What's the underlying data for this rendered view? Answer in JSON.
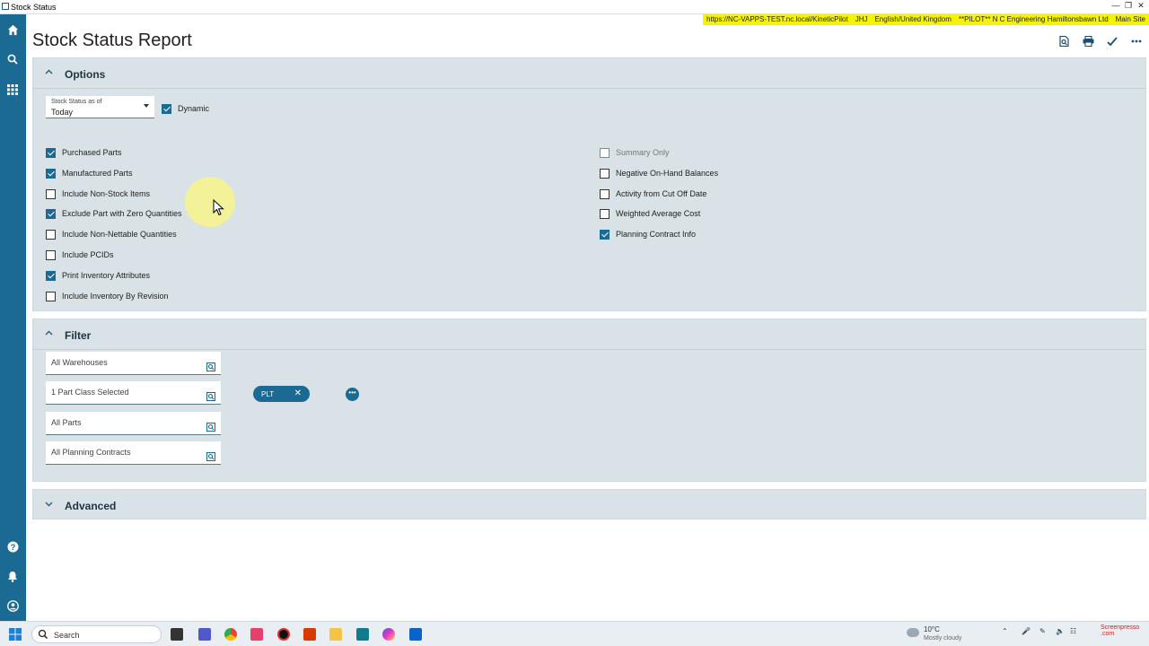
{
  "window": {
    "title": "Stock Status"
  },
  "infobar": {
    "items": [
      "https://NC-VAPPS-TEST.nc.local/KineticPilot",
      "JHJ",
      "English/United Kingdom",
      "**PILOT** N C Engineering Hamiltonsbawn Ltd",
      "Main Site"
    ]
  },
  "page": {
    "title": "Stock Status Report"
  },
  "toolbar": {
    "icons": [
      "preview-icon",
      "print-icon",
      "submit-icon",
      "more-icon"
    ]
  },
  "options": {
    "title": "Options",
    "stock_status": {
      "label": "Stock Status as of",
      "value": "Today"
    },
    "dynamic": {
      "label": "Dynamic",
      "checked": true
    },
    "left": [
      {
        "label": "Purchased Parts",
        "checked": true
      },
      {
        "label": "Manufactured Parts",
        "checked": true
      },
      {
        "label": "Include Non-Stock Items",
        "checked": false
      },
      {
        "label": "Exclude Part with Zero Quantities",
        "checked": true
      },
      {
        "label": "Include Non-Nettable Quantities",
        "checked": false
      },
      {
        "label": "Include PCIDs",
        "checked": false
      },
      {
        "label": "Print Inventory Attributes",
        "checked": true
      },
      {
        "label": "Include Inventory By Revision",
        "checked": false
      }
    ],
    "right": [
      {
        "label": "Summary Only",
        "checked": false,
        "disabled": true
      },
      {
        "label": "Negative On-Hand Balances",
        "checked": false
      },
      {
        "label": "Activity from Cut Off Date",
        "checked": false
      },
      {
        "label": "Weighted Average Cost",
        "checked": false
      },
      {
        "label": "Planning Contract Info",
        "checked": true
      }
    ]
  },
  "filter": {
    "title": "Filter",
    "lookups": [
      "All Warehouses",
      "1 Part Class Selected",
      "All Parts",
      "All Planning Contracts"
    ],
    "chip": {
      "label": "PLT"
    }
  },
  "advanced": {
    "title": "Advanced"
  },
  "taskbar": {
    "search_label": "Search",
    "weather_temp": "10°C",
    "weather_desc": "Mostly cloudy",
    "recorder": "Screenpresso .com"
  }
}
